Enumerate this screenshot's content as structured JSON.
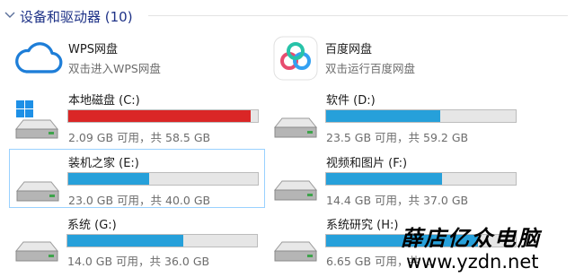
{
  "group": {
    "title": "设备和驱动器 (10)"
  },
  "apps": [
    {
      "name": "WPS网盘",
      "sub": "双击进入WPS网盘",
      "icon": "cloud-icon"
    },
    {
      "name": "百度网盘",
      "sub": "双击运行百度网盘",
      "icon": "baidu-netdisk-icon"
    }
  ],
  "drives": [
    {
      "name": "本地磁盘 (C:)",
      "sub": "2.09 GB 可用，共 58.5 GB",
      "used_fraction": 0.964,
      "bar_color": "#da2626",
      "icon": "windows-drive-icon"
    },
    {
      "name": "软件 (D:)",
      "sub": "23.5 GB 可用，共 59.2 GB",
      "used_fraction": 0.603,
      "bar_color": "#26a0da",
      "icon": "drive-icon"
    },
    {
      "name": "装机之家 (E:)",
      "sub": "23.0 GB 可用，共 40.0 GB",
      "used_fraction": 0.425,
      "bar_color": "#26a0da",
      "icon": "drive-icon"
    },
    {
      "name": "视频和图片 (F:)",
      "sub": "14.4 GB 可用，共 37.0 GB",
      "used_fraction": 0.611,
      "bar_color": "#26a0da",
      "icon": "drive-icon"
    },
    {
      "name": "系统 (G:)",
      "sub": "14.0 GB 可用，共 36.0 GB",
      "used_fraction": 0.611,
      "bar_color": "#26a0da",
      "icon": "drive-icon"
    },
    {
      "name": "系统研究 (H:)",
      "sub": "6.65 GB 可用，共 ...",
      "used_fraction": 0.8,
      "bar_color": "#26a0da",
      "icon": "drive-icon"
    }
  ],
  "watermark": {
    "text": "薛店亿众电脑",
    "url": "www.yzdn.net"
  }
}
